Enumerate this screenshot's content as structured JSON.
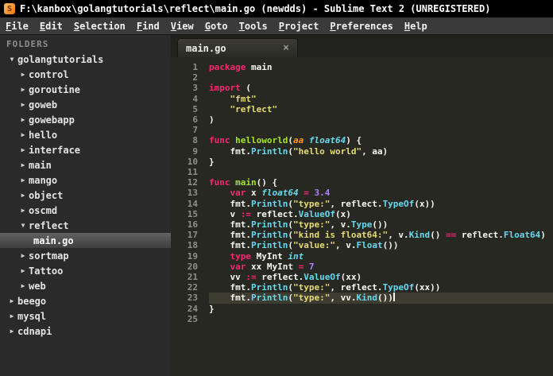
{
  "window": {
    "title": "F:\\kanbox\\golangtutorials\\reflect\\main.go (newdds) - Sublime Text 2 (UNREGISTERED)",
    "app_icon_letter": "S"
  },
  "menu_items": [
    "File",
    "Edit",
    "Selection",
    "Find",
    "View",
    "Goto",
    "Tools",
    "Project",
    "Preferences",
    "Help"
  ],
  "icons": {
    "folder_collapsed": "▶",
    "folder_expanded": "▼",
    "tab_close": "×"
  },
  "sidebar": {
    "header": "FOLDERS",
    "items": [
      {
        "label": "golangtutorials",
        "type": "folder",
        "depth": 0,
        "expanded": true
      },
      {
        "label": "control",
        "type": "folder",
        "depth": 1,
        "expanded": false
      },
      {
        "label": "goroutine",
        "type": "folder",
        "depth": 1,
        "expanded": false
      },
      {
        "label": "goweb",
        "type": "folder",
        "depth": 1,
        "expanded": false
      },
      {
        "label": "gowebapp",
        "type": "folder",
        "depth": 1,
        "expanded": false
      },
      {
        "label": "hello",
        "type": "folder",
        "depth": 1,
        "expanded": false
      },
      {
        "label": "interface",
        "type": "folder",
        "depth": 1,
        "expanded": false
      },
      {
        "label": "main",
        "type": "folder",
        "depth": 1,
        "expanded": false
      },
      {
        "label": "mango",
        "type": "folder",
        "depth": 1,
        "expanded": false
      },
      {
        "label": "object",
        "type": "folder",
        "depth": 1,
        "expanded": false
      },
      {
        "label": "oscmd",
        "type": "folder",
        "depth": 1,
        "expanded": false
      },
      {
        "label": "reflect",
        "type": "folder",
        "depth": 1,
        "expanded": true
      },
      {
        "label": "main.go",
        "type": "file",
        "depth": 2,
        "selected": true
      },
      {
        "label": "sortmap",
        "type": "folder",
        "depth": 1,
        "expanded": false
      },
      {
        "label": "Tattoo",
        "type": "folder",
        "depth": 1,
        "expanded": false
      },
      {
        "label": "web",
        "type": "folder",
        "depth": 1,
        "expanded": false
      },
      {
        "label": "beego",
        "type": "folder",
        "depth": 0,
        "expanded": false
      },
      {
        "label": "mysql",
        "type": "folder",
        "depth": 0,
        "expanded": false
      },
      {
        "label": "cdnapi",
        "type": "folder",
        "depth": 0,
        "expanded": false
      }
    ]
  },
  "tab": {
    "label": "main.go",
    "close_glyph": "×"
  },
  "editor": {
    "current_line": 23,
    "lines": [
      {
        "n": 1,
        "s": [
          [
            "k",
            "package"
          ],
          [
            "p",
            " main"
          ]
        ]
      },
      {
        "n": 2,
        "s": []
      },
      {
        "n": 3,
        "s": [
          [
            "k",
            "import"
          ],
          [
            "p",
            " ("
          ]
        ]
      },
      {
        "n": 4,
        "s": [
          [
            "p",
            "    "
          ],
          [
            "s",
            "\"fmt\""
          ]
        ]
      },
      {
        "n": 5,
        "s": [
          [
            "p",
            "    "
          ],
          [
            "s",
            "\"reflect\""
          ]
        ]
      },
      {
        "n": 6,
        "s": [
          [
            "p",
            ")"
          ]
        ]
      },
      {
        "n": 7,
        "s": []
      },
      {
        "n": 8,
        "s": [
          [
            "k",
            "func"
          ],
          [
            "p",
            " "
          ],
          [
            "f",
            "helloworld"
          ],
          [
            "p",
            "("
          ],
          [
            "a",
            "aa"
          ],
          [
            "p",
            " "
          ],
          [
            "t",
            "float64"
          ],
          [
            "p",
            ") {"
          ]
        ]
      },
      {
        "n": 9,
        "s": [
          [
            "p",
            "    fmt."
          ],
          [
            "u",
            "Println"
          ],
          [
            "p",
            "("
          ],
          [
            "s",
            "\"hello world\""
          ],
          [
            "p",
            ", aa)"
          ]
        ]
      },
      {
        "n": 10,
        "s": [
          [
            "p",
            "}"
          ]
        ]
      },
      {
        "n": 11,
        "s": []
      },
      {
        "n": 12,
        "s": [
          [
            "k",
            "func"
          ],
          [
            "p",
            " "
          ],
          [
            "f",
            "main"
          ],
          [
            "p",
            "() {"
          ]
        ]
      },
      {
        "n": 13,
        "s": [
          [
            "p",
            "    "
          ],
          [
            "k",
            "var"
          ],
          [
            "p",
            " x "
          ],
          [
            "t",
            "float64"
          ],
          [
            "p",
            " "
          ],
          [
            "o",
            "="
          ],
          [
            "p",
            " "
          ],
          [
            "m",
            "3.4"
          ]
        ]
      },
      {
        "n": 14,
        "s": [
          [
            "p",
            "    fmt."
          ],
          [
            "u",
            "Println"
          ],
          [
            "p",
            "("
          ],
          [
            "s",
            "\"type:\""
          ],
          [
            "p",
            ", reflect."
          ],
          [
            "u",
            "TypeOf"
          ],
          [
            "p",
            "(x))"
          ]
        ]
      },
      {
        "n": 15,
        "s": [
          [
            "p",
            "    v "
          ],
          [
            "o",
            ":="
          ],
          [
            "p",
            " reflect."
          ],
          [
            "u",
            "ValueOf"
          ],
          [
            "p",
            "(x)"
          ]
        ]
      },
      {
        "n": 16,
        "s": [
          [
            "p",
            "    fmt."
          ],
          [
            "u",
            "Println"
          ],
          [
            "p",
            "("
          ],
          [
            "s",
            "\"type:\""
          ],
          [
            "p",
            ", v."
          ],
          [
            "u",
            "Type"
          ],
          [
            "p",
            "())"
          ]
        ]
      },
      {
        "n": 17,
        "s": [
          [
            "p",
            "    fmt."
          ],
          [
            "u",
            "Println"
          ],
          [
            "p",
            "("
          ],
          [
            "s",
            "\"kind is float64:\""
          ],
          [
            "p",
            ", v."
          ],
          [
            "u",
            "Kind"
          ],
          [
            "p",
            "() "
          ],
          [
            "o",
            "=="
          ],
          [
            "p",
            " reflect."
          ],
          [
            "u",
            "Float64"
          ],
          [
            "p",
            ")"
          ]
        ]
      },
      {
        "n": 18,
        "s": [
          [
            "p",
            "    fmt."
          ],
          [
            "u",
            "Println"
          ],
          [
            "p",
            "("
          ],
          [
            "s",
            "\"value:\""
          ],
          [
            "p",
            ", v."
          ],
          [
            "u",
            "Float"
          ],
          [
            "p",
            "())"
          ]
        ]
      },
      {
        "n": 19,
        "s": [
          [
            "p",
            "    "
          ],
          [
            "k",
            "type"
          ],
          [
            "p",
            " MyInt "
          ],
          [
            "t",
            "int"
          ]
        ]
      },
      {
        "n": 20,
        "s": [
          [
            "p",
            "    "
          ],
          [
            "k",
            "var"
          ],
          [
            "p",
            " xx MyInt "
          ],
          [
            "o",
            "="
          ],
          [
            "p",
            " "
          ],
          [
            "m",
            "7"
          ]
        ]
      },
      {
        "n": 21,
        "s": [
          [
            "p",
            "    vv "
          ],
          [
            "o",
            ":="
          ],
          [
            "p",
            " reflect."
          ],
          [
            "u",
            "ValueOf"
          ],
          [
            "p",
            "(xx)"
          ]
        ]
      },
      {
        "n": 22,
        "s": [
          [
            "p",
            "    fmt."
          ],
          [
            "u",
            "Println"
          ],
          [
            "p",
            "("
          ],
          [
            "s",
            "\"type:\""
          ],
          [
            "p",
            ", reflect."
          ],
          [
            "u",
            "TypeOf"
          ],
          [
            "p",
            "(xx))"
          ]
        ]
      },
      {
        "n": 23,
        "s": [
          [
            "p",
            "    fmt."
          ],
          [
            "u",
            "Println"
          ],
          [
            "p",
            "("
          ],
          [
            "s",
            "\"type:\""
          ],
          [
            "p",
            ", vv."
          ],
          [
            "u",
            "Kind"
          ],
          [
            "p",
            "())"
          ]
        ],
        "active": true
      },
      {
        "n": 24,
        "s": [
          [
            "p",
            "}"
          ]
        ]
      },
      {
        "n": 25,
        "s": []
      }
    ]
  },
  "colors": {
    "editor-bg": "#272822",
    "line-highlight": "#3e3d32",
    "gutter": "#8f908a",
    "plain": "#f8f8f2",
    "keyword": "#f92672",
    "string": "#e6db74",
    "function": "#a6e22e",
    "type": "#66d9ef",
    "param": "#fd971f",
    "support": "#66d9ef",
    "number": "#ae81ff"
  }
}
